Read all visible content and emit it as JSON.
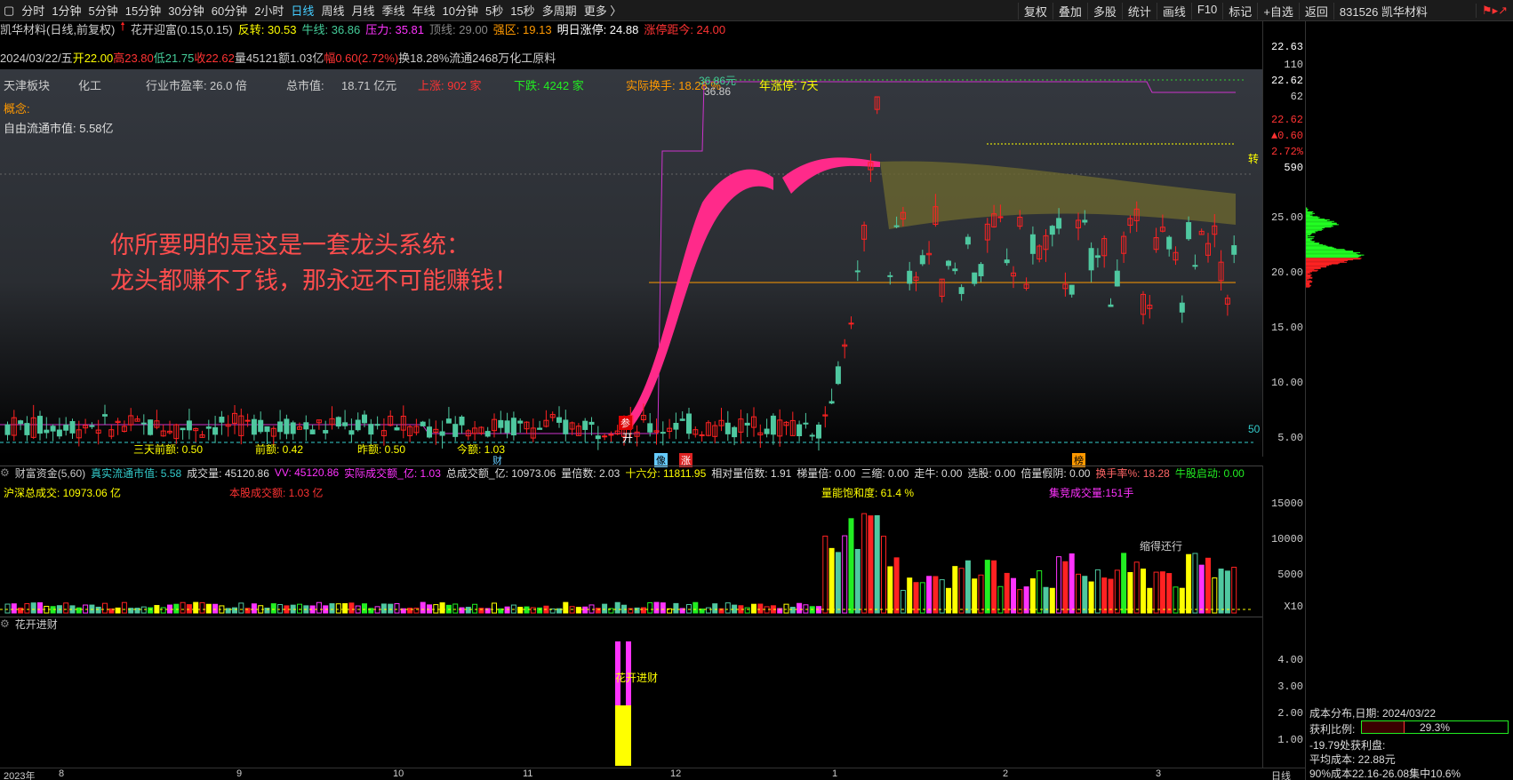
{
  "toolbar": {
    "periods": [
      "分时",
      "1分钟",
      "5分钟",
      "15分钟",
      "30分钟",
      "60分钟",
      "2小时",
      "日线",
      "周线",
      "月线",
      "季线",
      "年线",
      "10分钟",
      "5秒",
      "15秒",
      "多周期",
      "更多 〉"
    ],
    "active": "日线",
    "right_buttons": [
      "复权",
      "叠加",
      "多股",
      "统计",
      "画线",
      "F10",
      "标记",
      "+自选",
      "返回"
    ],
    "stock_code_name": "831526 凯华材料"
  },
  "header": {
    "stock": "凯华材料(日线,前复权)",
    "indicator": "花开迎富(0.15,0.15)",
    "fantan": "反转: 30.53",
    "niuxian": "牛线: 36.86",
    "yali": "压力: 35.81",
    "dingxian": "顶线: 29.00",
    "qiangqu": "强区: 19.13",
    "mingri": "明日涨停: 24.88",
    "zhangting": "涨停距今: 24.00"
  },
  "quote": {
    "date": "2024/03/22/五",
    "open": "开22.00",
    "high": "高23.80",
    "low": "低21.75",
    "close": "收22.62",
    "vol": "量45121",
    "amount": "额1.03亿",
    "change": "幅0.60(2.72%)",
    "turnover": "换18.28%",
    "float": "流通2468万",
    "industry": "化工原料"
  },
  "info": {
    "board": "天津板块",
    "sector": "化工",
    "pe_label": "行业市盈率:",
    "pe": "26.0 倍",
    "mcap_label": "总市值:",
    "mcap": "18.71 亿元",
    "up": "上涨: 902 家",
    "down": "下跌: 4242 家",
    "real_turnover": "实际换手: 18.28 %",
    "year_limit": "年涨停: 7天",
    "concept": "概念:",
    "free_float": "自由流通市值: 5.58亿",
    "price_tag": "36.86元",
    "price_tag2": "36.86"
  },
  "overlay_text": [
    "你所要明的是这是一套龙头系统：",
    "龙头都赚不了钱，那永远不可能赚钱！"
  ],
  "bottom_labels": {
    "three_day": "三天前额: 0.50",
    "prev": "前额: 0.42",
    "yesterday": "昨额: 0.50",
    "today": "今额: 1.03",
    "kai": "开",
    "can": "参",
    "xing": "星",
    "zhuan": "转",
    "fifty": "50"
  },
  "markers": {
    "cai": "财",
    "xiang": "像",
    "zhang": "涨",
    "bang": "榜"
  },
  "axis_main": [
    "22.63",
    "110",
    "22.62",
    "62",
    "22.62",
    "▲0.60",
    "2.72%",
    "590",
    "25.00",
    "20.00",
    "15.00",
    "10.00",
    "5.00"
  ],
  "vol_header": {
    "name": "财富资金(5,60)",
    "float_val": "真实流通市值: 5.58",
    "vol": "成交量: 45120.86",
    "vv": "VV: 45120.86",
    "real_amount": "实际成交额_亿: 1.03",
    "total_amount": "总成交额_亿: 10973.06",
    "ratio": "量倍数: 2.03",
    "sixteen": "十六分: 11811.95",
    "rel_ratio": "相对量倍数: 1.91",
    "ladder": "梯量倍: 0.00",
    "three_shrink": "三缩: 0.00",
    "walk_niu": "走牛: 0.00",
    "pick": "选股: 0.00",
    "fake_yin": "倍量假阴: 0.00",
    "turnover": "换手率%: 18.28",
    "niu_start": "牛股启动: 0.00"
  },
  "vol_info": {
    "sh_total": "沪深总成交: 10973.06 亿",
    "stock_amt": "本股成交额: 1.03 亿",
    "sat": "量能饱和度: 61.4 %",
    "auction": "集竞成交量:151手",
    "shrink": "缩得还行",
    "niu": "牛",
    "qi": "启",
    "huan": "换"
  },
  "axis_vol": [
    "15000",
    "10000",
    "5000",
    "X10"
  ],
  "third_panel": {
    "name": "花开进财",
    "label": "花开进财"
  },
  "axis_third": [
    "4.00",
    "3.00",
    "2.00",
    "1.00"
  ],
  "date_axis": [
    "2023年",
    "8",
    "9",
    "10",
    "11",
    "12",
    "1",
    "2",
    "3",
    "日线"
  ],
  "side_panel": {
    "title": "成本分布,日期: 2024/03/22",
    "profit_label": "获利比例:",
    "profit_val": "29.3%",
    "profit_frac": 0.293,
    "loss_line": "-19.79处获利盘:",
    "avg_cost": "平均成本: 22.88元",
    "concentration": "90%成本22.16-26.08集中10.6%"
  }
}
